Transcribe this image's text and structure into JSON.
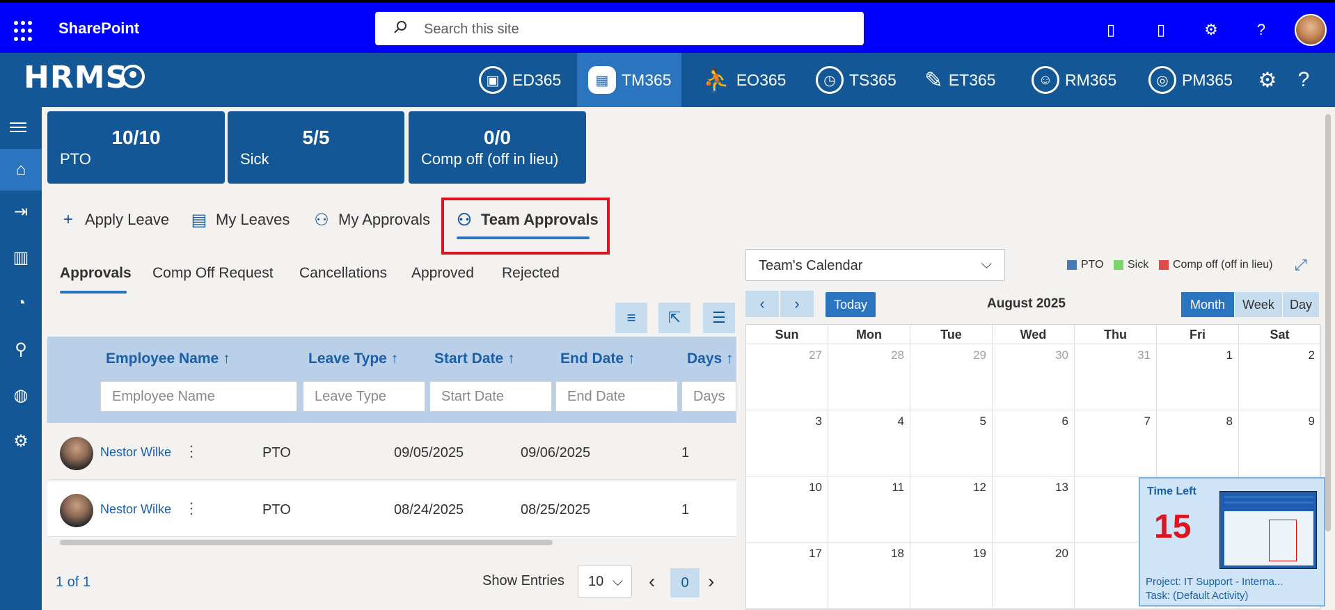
{
  "topbar": {
    "app_name": "SharePoint",
    "search_placeholder": "Search this site"
  },
  "nav": {
    "logo": "HRMS",
    "modules": [
      {
        "label": "ED365"
      },
      {
        "label": "TM365",
        "active": true
      },
      {
        "label": "EO365"
      },
      {
        "label": "TS365"
      },
      {
        "label": "ET365"
      },
      {
        "label": "RM365"
      },
      {
        "label": "PM365"
      }
    ]
  },
  "stats": [
    {
      "value": "10/10",
      "label": "PTO"
    },
    {
      "value": "5/5",
      "label": "Sick"
    },
    {
      "value": "0/0",
      "label": "Comp off (off in lieu)"
    }
  ],
  "actions": {
    "apply": "Apply Leave",
    "my_leaves": "My Leaves",
    "my_approvals": "My Approvals",
    "team_approvals": "Team Approvals"
  },
  "subtabs": [
    "Approvals",
    "Comp Off Request",
    "Cancellations",
    "Approved",
    "Rejected"
  ],
  "grid": {
    "columns": [
      "Employee Name ↑",
      "Leave Type ↑",
      "Start Date ↑",
      "End Date ↑",
      "Days ↑"
    ],
    "filters": [
      "Employee Name",
      "Leave Type",
      "Start Date",
      "End Date",
      "Days"
    ],
    "rows": [
      {
        "name": "Nestor Wilke",
        "type": "PTO",
        "start": "09/05/2025",
        "end": "09/06/2025",
        "days": "1"
      },
      {
        "name": "Nestor Wilke",
        "type": "PTO",
        "start": "08/24/2025",
        "end": "08/25/2025",
        "days": "1"
      }
    ]
  },
  "pager": {
    "summary": "1 of 1",
    "show_entries": "Show Entries",
    "entries": "10",
    "page": "0"
  },
  "calendar": {
    "selector": "Team's Calendar",
    "legend": [
      {
        "label": "PTO",
        "color": "#4a7ab5"
      },
      {
        "label": "Sick",
        "color": "#7fd36b"
      },
      {
        "label": "Comp off (off in lieu)",
        "color": "#e04a4a"
      }
    ],
    "today": "Today",
    "title": "August 2025",
    "views": [
      "Month",
      "Week",
      "Day"
    ],
    "days": [
      "Sun",
      "Mon",
      "Tue",
      "Wed",
      "Thu",
      "Fri",
      "Sat"
    ],
    "weeks": [
      [
        "27",
        "28",
        "29",
        "30",
        "31",
        "1",
        "2"
      ],
      [
        "3",
        "4",
        "5",
        "6",
        "7",
        "8",
        "9"
      ],
      [
        "10",
        "11",
        "12",
        "13",
        "",
        "",
        ""
      ],
      [
        "17",
        "18",
        "19",
        "20",
        "",
        "",
        ""
      ]
    ]
  },
  "time_left": {
    "title": "Time Left",
    "value": "15",
    "project": "Project: IT Support - Interna...",
    "task": "Task: (Default Activity)"
  }
}
